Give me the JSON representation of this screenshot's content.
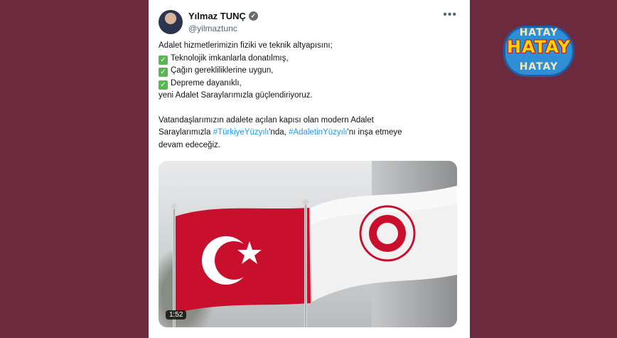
{
  "tweet": {
    "author_name": "Yılmaz TUNÇ",
    "handle": "@yilmaztunc",
    "intro": "Adalet hizmetlerimizin fiziki ve teknik altyapısını;",
    "checks": [
      "Teknolojik imkanlarla donatılmış,",
      "Çağın gerekliliklerine uygun,",
      "Depreme dayanıklı,"
    ],
    "closing": "yeni Adalet Saraylarımızla güçlendiriyoruz.",
    "p2_line1": "Vatandaşlarımızın adalete açılan kapısı olan modern Adalet",
    "p2_line2_pre": "Saraylarımızla ",
    "hashtag1": "#TürkiyeYüzyılı",
    "p2_line2_mid": "'nda, ",
    "hashtag2": "#AdaletinYüzyılı",
    "p2_line2_post": "'nı inşa etmeye",
    "p2_line3": "devam edeceğiz.",
    "video_duration": "1:52"
  },
  "icons": {
    "verified": "verified-badge-icon",
    "more": "more-options-icon",
    "check": "check-mark-icon"
  },
  "logo": {
    "text": "HATAY"
  },
  "colors": {
    "background": "#6b2a3e",
    "hashtag": "#1d9bf0",
    "check": "#5ab552",
    "logo_blue": "#2e8fd6",
    "logo_yellow": "#ffd400"
  }
}
